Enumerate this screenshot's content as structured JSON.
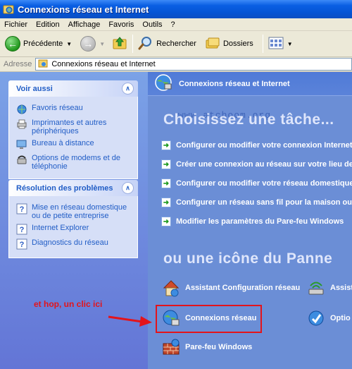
{
  "window": {
    "title": "Connexions réseau et Internet"
  },
  "menu": [
    "Fichier",
    "Edition",
    "Affichage",
    "Favoris",
    "Outils",
    "?"
  ],
  "toolbar": {
    "back_label": "Précédente",
    "search_label": "Rechercher",
    "folders_label": "Dossiers"
  },
  "address": {
    "label": "Adresse",
    "value": "Connexions réseau et Internet"
  },
  "sidebar": {
    "see_also": {
      "title": "Voir aussi",
      "items": [
        {
          "label": "Favoris réseau",
          "icon": "network-places-icon"
        },
        {
          "label": "Imprimantes et autres périphériques",
          "icon": "printer-icon"
        },
        {
          "label": "Bureau à distance",
          "icon": "remote-desktop-icon"
        },
        {
          "label": "Options de modems et de téléphonie",
          "icon": "phone-modem-icon"
        }
      ]
    },
    "troubleshoot": {
      "title": "Résolution des problèmes",
      "items": [
        {
          "label": "Mise en réseau domestique ou de petite entreprise",
          "icon": "help-icon"
        },
        {
          "label": "Internet Explorer",
          "icon": "help-icon"
        },
        {
          "label": "Diagnostics du réseau",
          "icon": "help-icon"
        }
      ]
    }
  },
  "main": {
    "header": "Connexions réseau et Internet",
    "watermark": "www.atchoom.org",
    "pick_task": "Choisissez une tâche...",
    "tasks": [
      "Configurer ou modifier votre connexion Internet",
      "Créer une connexion au réseau sur votre lieu de b",
      "Configurer ou modifier votre réseau domestique o",
      "Configurer un réseau sans fil pour la maison ou u",
      "Modifier les paramètres du Pare-feu Windows"
    ],
    "or_icon": "ou une icône du Panne",
    "icons": [
      {
        "label": "Assistant Configuration réseau",
        "icon": "home-network-icon"
      },
      {
        "label": "Assist",
        "icon": "wireless-wizard-icon"
      },
      {
        "label": "Connexions réseau",
        "icon": "network-connections-icon"
      },
      {
        "label": "Optio",
        "icon": "internet-options-icon"
      },
      {
        "label": "Pare-feu Windows",
        "icon": "firewall-icon"
      }
    ]
  },
  "annotation": {
    "text": "et hop, un clic ici",
    "color": "#e3141b"
  }
}
